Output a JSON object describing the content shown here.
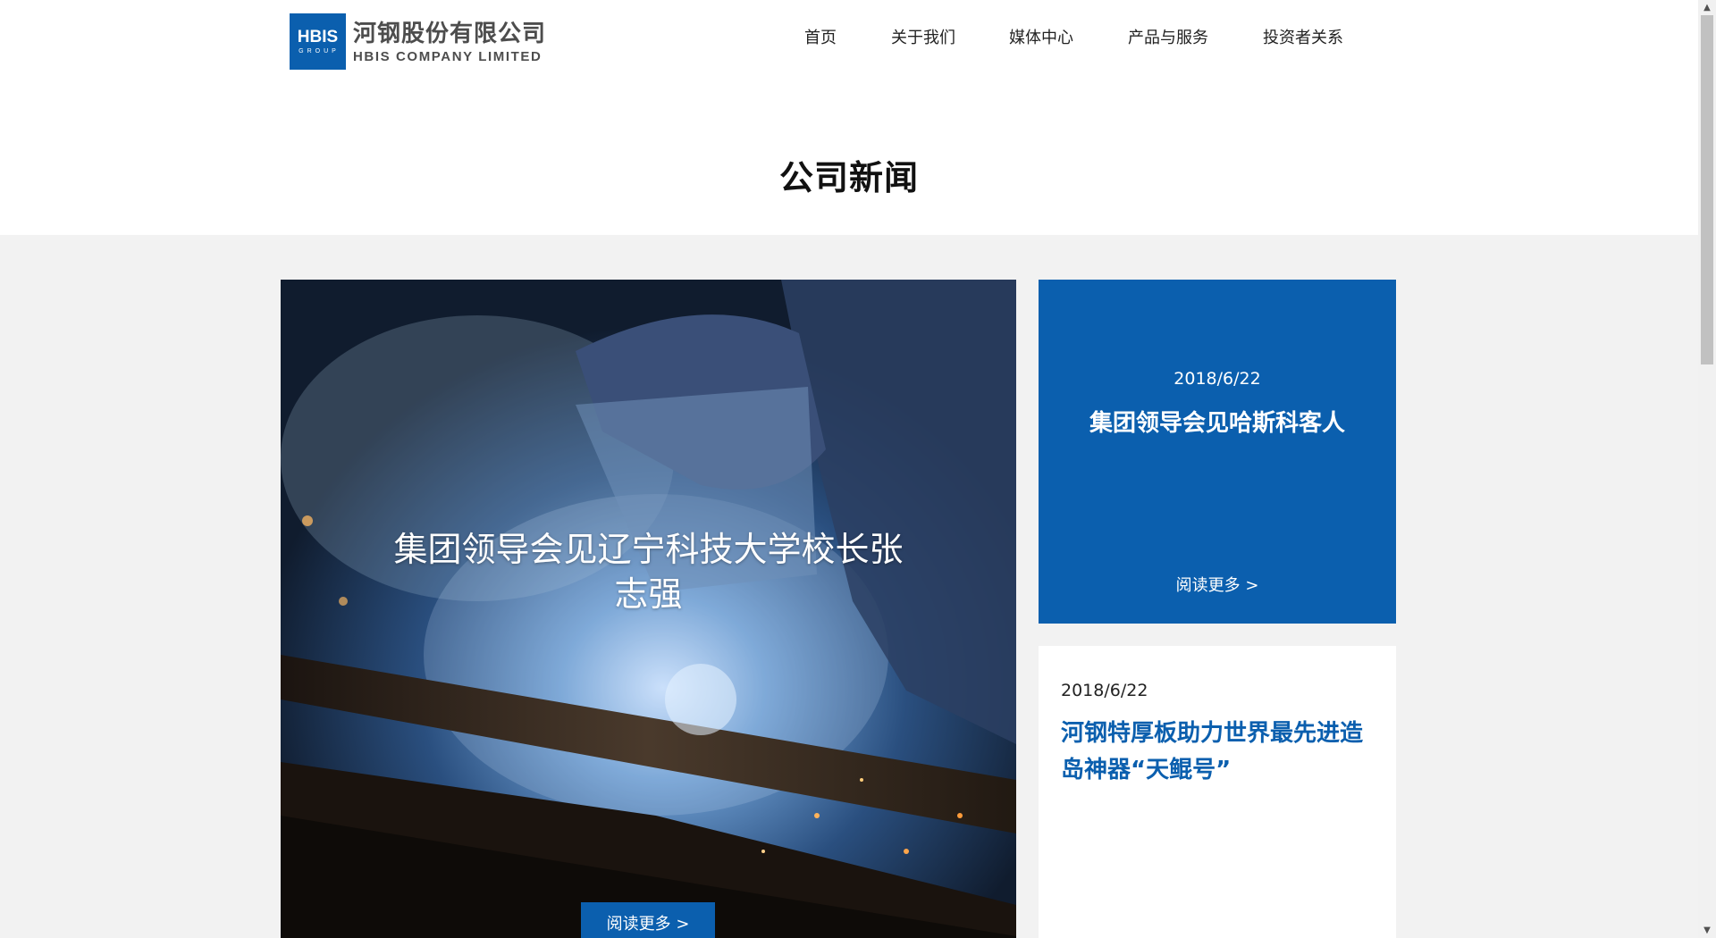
{
  "header": {
    "logo": {
      "mark": "HBIS",
      "mark_sub": "GROUP",
      "name_cn": "河钢股份有限公司",
      "name_en": "HBIS COMPANY LIMITED"
    },
    "nav": [
      "首页",
      "关于我们",
      "媒体中心",
      "产品与服务",
      "投资者关系"
    ]
  },
  "page_title": "公司新闻",
  "feature": {
    "title": "集团领导会见辽宁科技大学校长张志强",
    "more": "阅读更多 >"
  },
  "cards": [
    {
      "date": "2018/6/22",
      "title": "集团领导会见哈斯科客人",
      "more": "阅读更多 >"
    },
    {
      "date": "2018/6/22",
      "title": "河钢特厚板助力世界最先进造岛神器“天鲲号”"
    }
  ],
  "colors": {
    "brand_blue": "#0b5fae",
    "background": "#f2f2f2"
  }
}
